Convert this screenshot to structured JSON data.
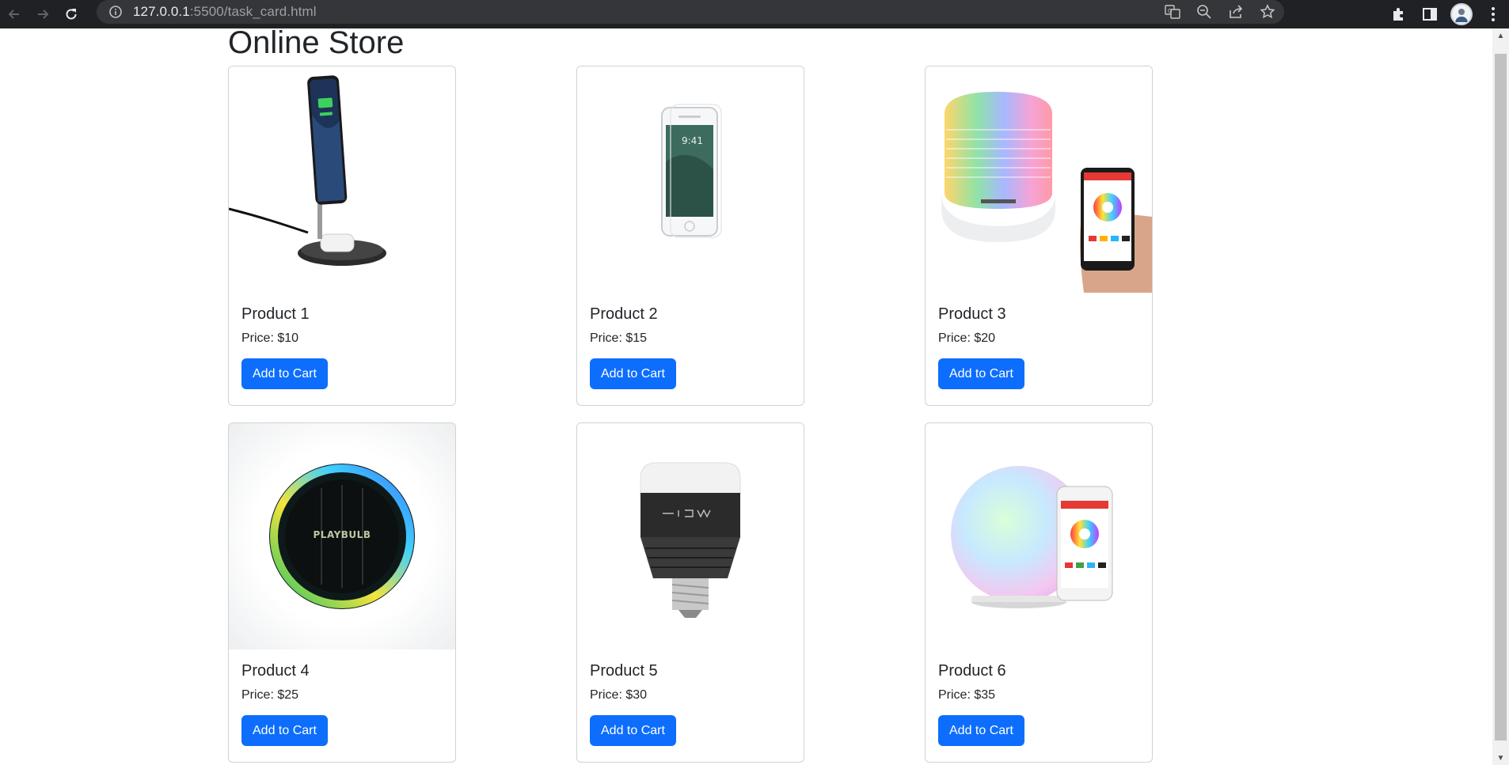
{
  "browser": {
    "url_host": "127.0.0.1",
    "url_rest": ":5500/task_card.html",
    "icons": [
      "back-icon",
      "forward-icon",
      "reload-icon",
      "site-info-icon",
      "translate-icon",
      "zoom-out-icon",
      "share-icon",
      "bookmark-star-icon",
      "extensions-icon",
      "side-panel-icon",
      "profile-avatar",
      "menu-kebab-icon"
    ]
  },
  "page": {
    "title": "Online Store"
  },
  "products": [
    {
      "name": "Product 1",
      "price": "Price: $10",
      "button": "Add to Cart",
      "image": "magsafe-charger-stand"
    },
    {
      "name": "Product 2",
      "price": "Price: $15",
      "button": "Add to Cart",
      "image": "glass-screen-protector"
    },
    {
      "name": "Product 3",
      "price": "Price: $20",
      "button": "Add to Cart",
      "image": "playbulb-candle-lamp"
    },
    {
      "name": "Product 4",
      "price": "Price: $25",
      "button": "Add to Cart",
      "image": "playbulb-solar-light",
      "image_text": "PLAYBULB"
    },
    {
      "name": "Product 5",
      "price": "Price: $30",
      "button": "Add to Cart",
      "image": "mipow-smart-bulb"
    },
    {
      "name": "Product 6",
      "price": "Price: $35",
      "button": "Add to Cart",
      "image": "color-globe-lamp"
    }
  ],
  "colors": {
    "primary": "#0d6efd",
    "chrome": "#202124",
    "omnibox": "#35363a"
  }
}
